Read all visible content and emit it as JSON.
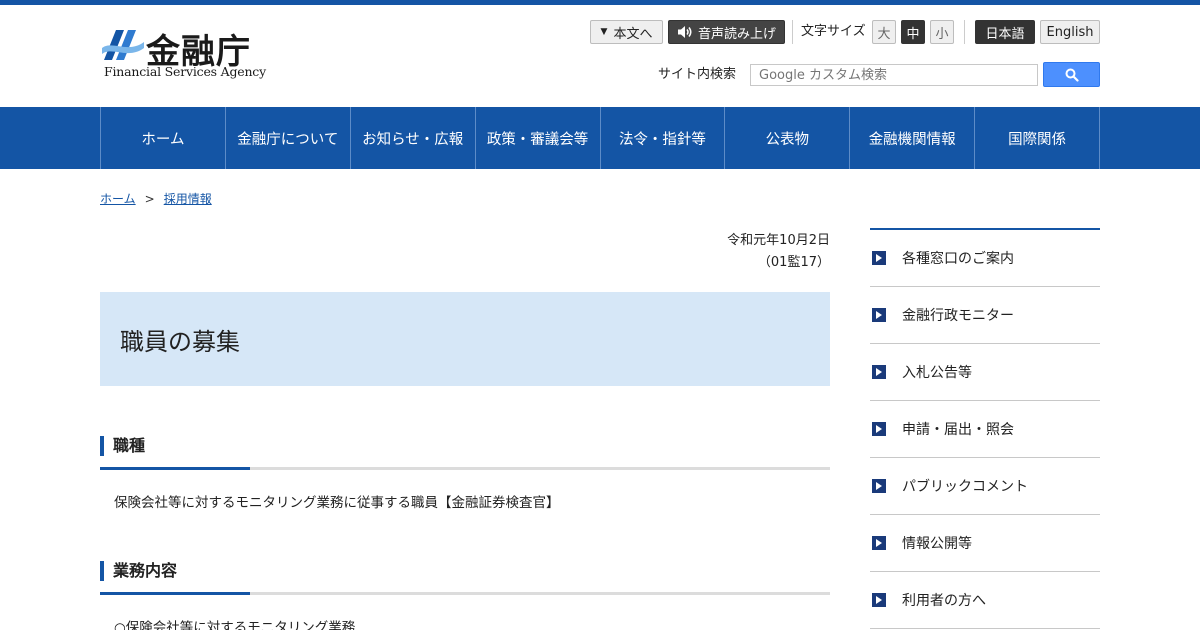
{
  "header": {
    "logo_jp": "金融庁",
    "logo_en": "Financial Services Agency",
    "skip_label": "本文へ",
    "voice_label": "音声読み上げ",
    "font_size_label": "文字サイズ",
    "font_sizes": [
      "大",
      "中",
      "小"
    ],
    "lang_ja": "日本語",
    "lang_en": "English",
    "search_label": "サイト内検索",
    "search_placeholder": "Google カスタム検索"
  },
  "nav": [
    "ホーム",
    "金融庁について",
    "お知らせ・広報",
    "政策・審議会等",
    "法令・指針等",
    "公表物",
    "金融機関情報",
    "国際関係"
  ],
  "breadcrumb": {
    "home": "ホーム",
    "separator": ">",
    "current": "採用情報"
  },
  "main": {
    "date": "令和元年10月2日",
    "doc_no": "（01監17）",
    "title": "職員の募集",
    "sections": [
      {
        "heading": "職種",
        "text": "保険会社等に対するモニタリング業務に従事する職員【金融証券検査官】"
      },
      {
        "heading": "業務内容",
        "text": "○保険会社等に対するモニタリング業務"
      }
    ]
  },
  "sidebar": [
    "各種窓口のご案内",
    "金融行政モニター",
    "入札公告等",
    "申請・届出・照会",
    "パブリックコメント",
    "情報公開等",
    "利用者の方へ"
  ],
  "colors": {
    "brand_blue": "#1455a5",
    "title_bg": "#d6e7f7",
    "search_blue": "#4d90fe"
  }
}
